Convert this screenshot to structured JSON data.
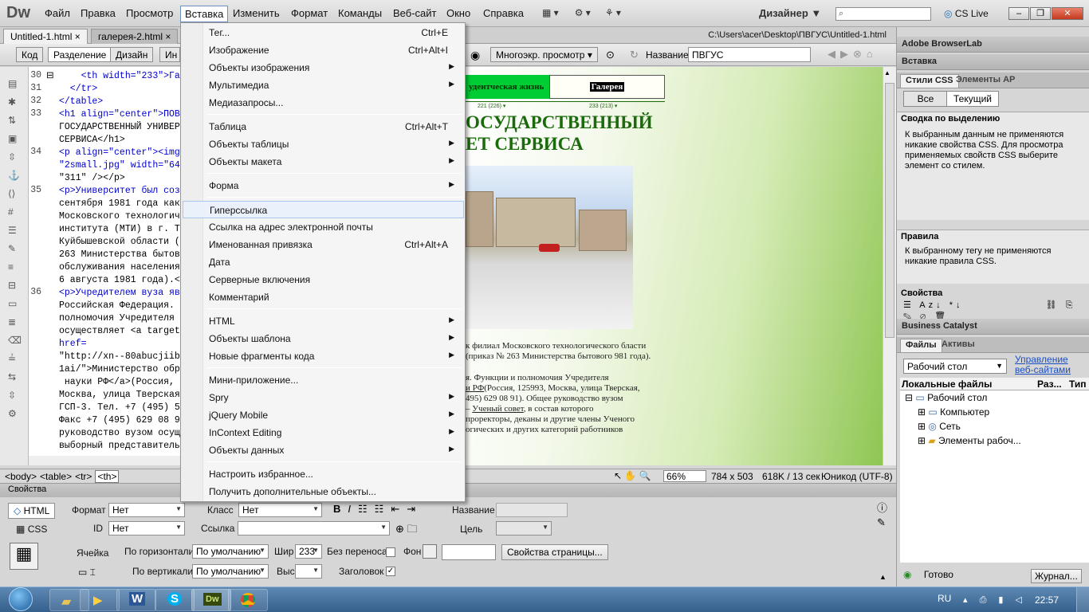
{
  "app": {
    "logo": "Dw",
    "workspace": "Дизайнер",
    "cslive": "CS Live",
    "search_placeholder": ""
  },
  "menubar": [
    "Файл",
    "Правка",
    "Просмотр",
    "Вставка",
    "Изменить",
    "Формат",
    "Команды",
    "Веб-сайт",
    "Окно",
    "Справка"
  ],
  "tabs": {
    "t1": "Untitled-1.html",
    "t2": "галерея-2.html",
    "path": "C:\\Users\\acer\\Desktop\\ПВГУС\\Untitled-1.html"
  },
  "doctoolbar": {
    "code": "Код",
    "split": "Разделение",
    "design": "Дизайн",
    "live": "Ин",
    "multiscreen": "Многоэкр. просмотр",
    "title_label": "Название:",
    "title_value": "ПВГУС"
  },
  "code": {
    "lines": [
      {
        "n": "30",
        "t": "    <th width=\"233\">Га"
      },
      {
        "n": "31",
        "t": "  </tr>"
      },
      {
        "n": "32",
        "t": "</table>"
      },
      {
        "n": "33",
        "t": "<h1 align=\"center\">ПОВ"
      },
      {
        "n": "",
        "t": "ГОСУДАРСТВЕННЫЙ УНИВЕР"
      },
      {
        "n": "",
        "t": "СЕРВИСА</h1>"
      },
      {
        "n": "34",
        "t": "<p align=\"center\"><img"
      },
      {
        "n": "",
        "t": "\"2small.jpg\" width=\"64"
      },
      {
        "n": "",
        "t": "\"311\" /></p>"
      },
      {
        "n": "35",
        "t": "<p>Университет был соз"
      },
      {
        "n": "",
        "t": "сентября 1981 года как"
      },
      {
        "n": "",
        "t": "Московского технологич"
      },
      {
        "n": "",
        "t": "института (МТИ) в г. Т"
      },
      {
        "n": "",
        "t": "Куйбышевской области ("
      },
      {
        "n": "",
        "t": "263 Министерства бытов"
      },
      {
        "n": "",
        "t": "обслуживания населения"
      },
      {
        "n": "",
        "t": "6 августа 1981 года).<"
      },
      {
        "n": "36",
        "t": "<p>Учредителем вуза яв"
      },
      {
        "n": "",
        "t": "Российская Федерация. "
      },
      {
        "n": "",
        "t": "полномочия Учредителя "
      },
      {
        "n": "",
        "t": "осуществляет <a target"
      },
      {
        "n": "",
        "t": "href="
      },
      {
        "n": "",
        "t": "\"http://xn--80abucjiib"
      },
      {
        "n": "",
        "t": "1ai/\">Министерство обр"
      },
      {
        "n": "",
        "t": " науки РФ</a>(Россия,"
      },
      {
        "n": "",
        "t": "Москва, улица Тверская"
      },
      {
        "n": "",
        "t": "ГСП-3. Тел. +7 (495) 5"
      },
      {
        "n": "",
        "t": "Факс +7 (495) 629 08 9"
      },
      {
        "n": "",
        "t": "руководство вузом осущ"
      },
      {
        "n": "",
        "t": "выборный представитель"
      }
    ]
  },
  "design": {
    "cell1": "удентческая жизнь",
    "cell2": "Галерея",
    "width1": "221 (226) ▾",
    "width2": "233 (213) ▾",
    "heading1": "ОСУДАРСТВЕННЫЙ",
    "heading2": "ЕТ СЕРВИСА",
    "p1": "к филиал Московского технологического бласти (приказ № 263 Министерства бытового 981 года).",
    "p2": "я. Функции и полномочия Учредителя",
    "p3a": "и РФ",
    "p3b": "(Россия, 125993, Москва, улица Тверская,",
    "p4": "495) 629 08 91). Общее руководство вузом",
    "p5a": "– ",
    "p5link": "Ученый совет",
    "p5b": ", в состав которого",
    "p6": "проректоры, деканы и другие члены Ученого",
    "p7": "огических и других категорий работников"
  },
  "statusbar": {
    "tags": [
      "<body>",
      "<table>",
      "<tr>",
      "<th>"
    ],
    "zoom": "66%",
    "size": "784 x 503",
    "weight": "618K / 13 сек",
    "encoding": "Юникод (UTF-8)"
  },
  "props": {
    "title": "Свойства",
    "html": "HTML",
    "css": "CSS",
    "format_label": "Формат",
    "format_value": "Нет",
    "class_label": "Класс",
    "class_value": "Нет",
    "id_label": "ID",
    "id_value": "Нет",
    "link_label": "Ссылка",
    "link_value": "",
    "name_label": "Название",
    "target_label": "Цель",
    "cell_label": "Ячейка",
    "horiz_label": "По горизонтали",
    "horiz_value": "По умолчанию",
    "vert_label": "По вертикали",
    "vert_value": "По умолчанию",
    "width_label": "Шир",
    "width_value": "233",
    "height_label": "Выс",
    "height_value": "",
    "nowrap_label": "Без переноса",
    "header_label": "Заголовок",
    "header_checked": "✓",
    "bg_label": "Фон",
    "pageprops": "Свойства страницы..."
  },
  "right": {
    "browserlab": "Adobe BrowserLab",
    "insert": "Вставка",
    "css_tab": "Стили CSS",
    "ap_tab": "Элементы AP",
    "all": "Все",
    "current": "Текущий",
    "summary_title": "Сводка по выделению",
    "summary_text": "К выбранным данным не применяются никакие свойства CSS.  Для просмотра применяемых свойств CSS выберите элемент со стилем.",
    "rules_title": "Правила",
    "rules_text": "К выбранному тегу не применяются никакие правила CSS.",
    "props_title": "Свойства",
    "catalyst": "Business Catalyst",
    "files_tab": "Файлы",
    "assets_tab": "Активы",
    "site_select": "Рабочий стол",
    "manage": "Управление веб-сайтами",
    "col_local": "Локальные файлы",
    "col_size": "Раз...",
    "col_type": "Тип",
    "tree": [
      "Рабочий стол",
      "Компьютер",
      "Сеть",
      "Элементы рабоч..."
    ],
    "ready": "Готово",
    "log": "Журнал..."
  },
  "menu": {
    "items": [
      {
        "label": "Тег...",
        "sc": "Ctrl+E",
        "sub": false
      },
      {
        "label": "Изображение",
        "sc": "Ctrl+Alt+I",
        "sub": false
      },
      {
        "label": "Объекты изображения",
        "sc": "",
        "sub": true
      },
      {
        "label": "Мультимедиа",
        "sc": "",
        "sub": true
      },
      {
        "label": "Медиазапросы...",
        "sc": "",
        "sub": false
      },
      {
        "label": "Таблица",
        "sc": "Ctrl+Alt+T",
        "sub": false
      },
      {
        "label": "Объекты таблицы",
        "sc": "",
        "sub": true
      },
      {
        "label": "Объекты макета",
        "sc": "",
        "sub": true
      },
      {
        "label": "Форма",
        "sc": "",
        "sub": true
      },
      {
        "label": "Гиперссылка",
        "sc": "",
        "sub": false
      },
      {
        "label": "Ссылка на адрес электронной почты",
        "sc": "",
        "sub": false
      },
      {
        "label": "Именованная привязка",
        "sc": "Ctrl+Alt+A",
        "sub": false
      },
      {
        "label": "Дата",
        "sc": "",
        "sub": false
      },
      {
        "label": "Серверные включения",
        "sc": "",
        "sub": false
      },
      {
        "label": "Комментарий",
        "sc": "",
        "sub": false
      },
      {
        "label": "HTML",
        "sc": "",
        "sub": true
      },
      {
        "label": "Объекты шаблона",
        "sc": "",
        "sub": true
      },
      {
        "label": "Новые фрагменты кода",
        "sc": "",
        "sub": true
      },
      {
        "label": "Мини-приложение...",
        "sc": "",
        "sub": false
      },
      {
        "label": "Spry",
        "sc": "",
        "sub": true
      },
      {
        "label": "jQuery Mobile",
        "sc": "",
        "sub": true
      },
      {
        "label": "InContext Editing",
        "sc": "",
        "sub": true
      },
      {
        "label": "Объекты данных",
        "sc": "",
        "sub": true
      },
      {
        "label": "Настроить избранное...",
        "sc": "",
        "sub": false
      },
      {
        "label": "Получить дополнительные объекты...",
        "sc": "",
        "sub": false
      }
    ],
    "highlighted": "Гиперссылка"
  },
  "taskbar": {
    "lang": "RU",
    "time": "22:57"
  },
  "colors": {
    "accent": "#6e8fbf",
    "green_cell": "#00cc33",
    "heading": "#1b6b0c",
    "taskbar": "#355f8c"
  }
}
